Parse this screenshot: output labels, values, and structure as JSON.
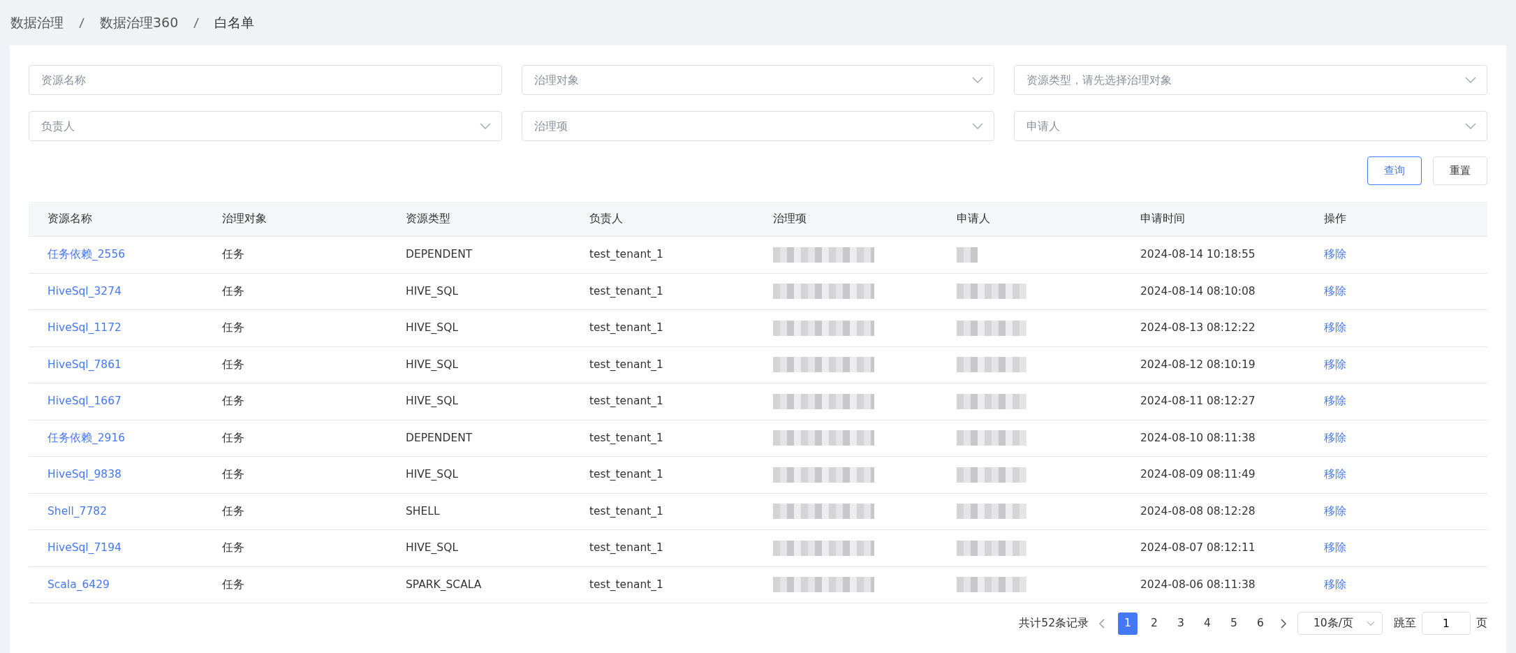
{
  "breadcrumb": [
    "数据治理",
    "数据治理360",
    "白名单"
  ],
  "filters": [
    {
      "kind": "input",
      "placeholder": "资源名称"
    },
    {
      "kind": "select",
      "placeholder": "治理对象"
    },
    {
      "kind": "select",
      "placeholder": "资源类型，请先选择治理对象"
    },
    {
      "kind": "select",
      "placeholder": "负责人"
    },
    {
      "kind": "select",
      "placeholder": "治理项"
    },
    {
      "kind": "select",
      "placeholder": "申请人"
    }
  ],
  "buttons": [
    {
      "kind": "primary",
      "label": "查询"
    },
    {
      "kind": "default",
      "label": "重置"
    }
  ],
  "table": {
    "columns": [
      "资源名称",
      "治理对象",
      "资源类型",
      "负责人",
      "治理项",
      "申请人",
      "申请时间",
      "操作"
    ],
    "rows": [
      {
        "resource_name": "任务依赖_2556",
        "object": "任务",
        "type": "DEPENDENT",
        "owner": "test_tenant_1",
        "time": "2024-08-14 10:18:55",
        "action": "移除"
      },
      {
        "resource_name": "HiveSql_3274",
        "object": "任务",
        "type": "HIVE_SQL",
        "owner": "test_tenant_1",
        "time": "2024-08-14 08:10:08",
        "action": "移除"
      },
      {
        "resource_name": "HiveSql_1172",
        "object": "任务",
        "type": "HIVE_SQL",
        "owner": "test_tenant_1",
        "time": "2024-08-13 08:12:22",
        "action": "移除"
      },
      {
        "resource_name": "HiveSql_7861",
        "object": "任务",
        "type": "HIVE_SQL",
        "owner": "test_tenant_1",
        "time": "2024-08-12 08:10:19",
        "action": "移除"
      },
      {
        "resource_name": "HiveSql_1667",
        "object": "任务",
        "type": "HIVE_SQL",
        "owner": "test_tenant_1",
        "time": "2024-08-11 08:12:27",
        "action": "移除"
      },
      {
        "resource_name": "任务依赖_2916",
        "object": "任务",
        "type": "DEPENDENT",
        "owner": "test_tenant_1",
        "time": "2024-08-10 08:11:38",
        "action": "移除"
      },
      {
        "resource_name": "HiveSql_9838",
        "object": "任务",
        "type": "HIVE_SQL",
        "owner": "test_tenant_1",
        "time": "2024-08-09 08:11:49",
        "action": "移除"
      },
      {
        "resource_name": "Shell_7782",
        "object": "任务",
        "type": "SHELL",
        "owner": "test_tenant_1",
        "time": "2024-08-08 08:12:28",
        "action": "移除"
      },
      {
        "resource_name": "HiveSql_7194",
        "object": "任务",
        "type": "HIVE_SQL",
        "owner": "test_tenant_1",
        "time": "2024-08-07 08:12:11",
        "action": "移除"
      },
      {
        "resource_name": "Scala_6429",
        "object": "任务",
        "type": "SPARK_SCALA",
        "owner": "test_tenant_1",
        "time": "2024-08-06 08:11:38",
        "action": "移除"
      }
    ]
  },
  "pagination": {
    "total": "共计52条记录",
    "pages": [
      {
        "label": "1",
        "selected": true
      },
      {
        "label": "2",
        "selected": false
      },
      {
        "label": "3",
        "selected": false
      },
      {
        "label": "4",
        "selected": false
      },
      {
        "label": "5",
        "selected": false
      },
      {
        "label": "6",
        "selected": false
      }
    ],
    "page_size": "10条/页",
    "jump_label": "跳至",
    "jump_value": "1",
    "page_unit": "页"
  }
}
